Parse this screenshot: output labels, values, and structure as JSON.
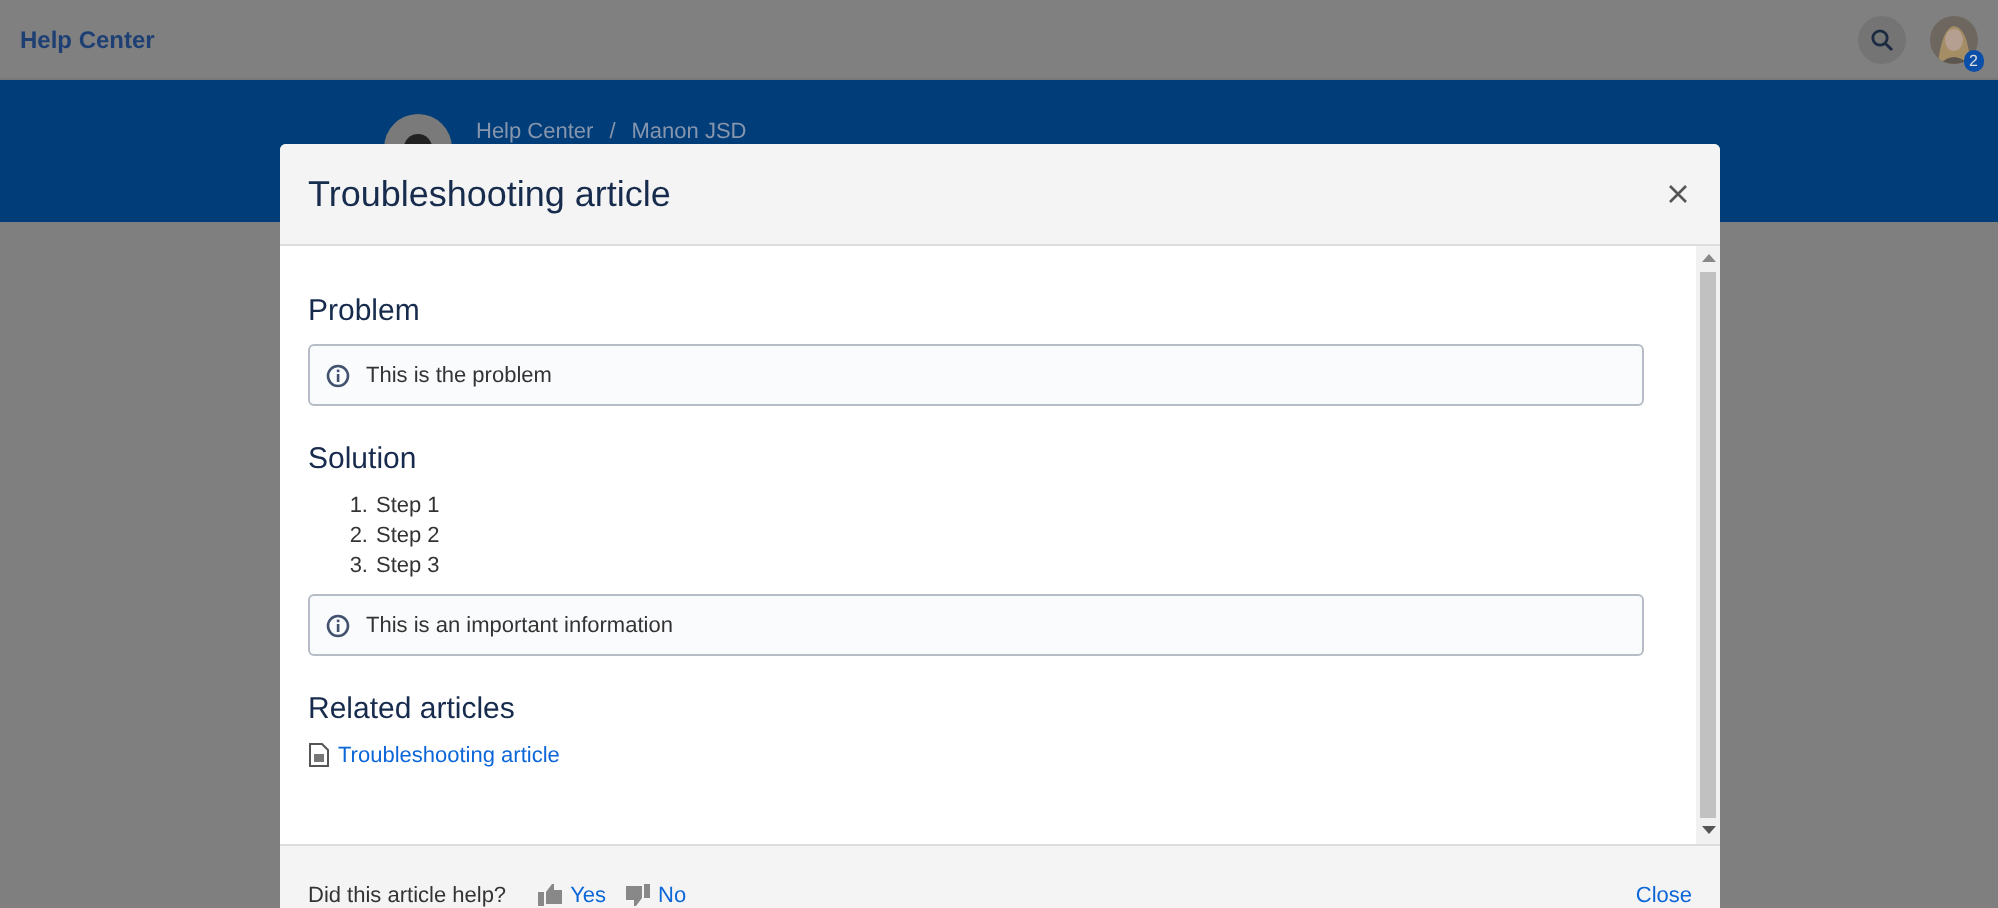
{
  "background": {
    "top_bar": {
      "title": "Help Center",
      "notification_count": "2"
    },
    "breadcrumb": {
      "items": [
        "Help Center",
        "Manon JSD"
      ],
      "separator": "/"
    }
  },
  "dialog": {
    "title": "Troubleshooting article",
    "sections": [
      {
        "heading": "Problem",
        "blocks": [
          {
            "kind": "info",
            "text": "This is the problem"
          }
        ]
      },
      {
        "heading": "Solution",
        "blocks": [
          {
            "kind": "steps",
            "items": [
              {
                "marker": "1.",
                "text": "Step 1"
              },
              {
                "marker": "2.",
                "text": "Step 2"
              },
              {
                "marker": "3.",
                "text": "Step 3"
              }
            ]
          },
          {
            "kind": "info",
            "text": "This is an important information"
          }
        ]
      },
      {
        "heading": "Related articles",
        "blocks": [
          {
            "kind": "links",
            "items": [
              "Troubleshooting article"
            ]
          }
        ]
      }
    ],
    "footer": {
      "question": "Did this article help?",
      "yes": "Yes",
      "no": "No",
      "close": "Close"
    }
  }
}
